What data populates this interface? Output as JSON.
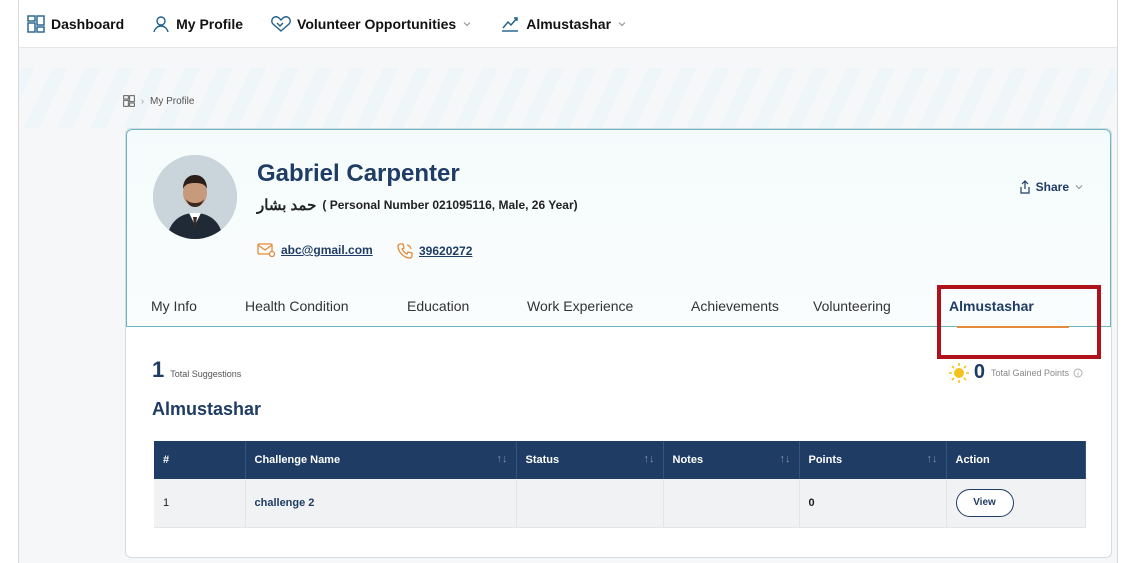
{
  "nav": {
    "dashboard": "Dashboard",
    "my_profile": "My Profile",
    "volunteer": "Volunteer Opportunities",
    "almustashar": "Almustashar"
  },
  "breadcrumb": {
    "current": "My Profile"
  },
  "profile": {
    "name": "Gabriel Carpenter",
    "arabic_name": "حمد بشار",
    "details": "( Personal Number 021095116, Male, 26 Year)",
    "email": "abc@gmail.com",
    "phone": "39620272",
    "share_label": "Share"
  },
  "tabs": [
    {
      "label": "My Info"
    },
    {
      "label": "Health Condition"
    },
    {
      "label": "Education"
    },
    {
      "label": "Work Experience"
    },
    {
      "label": "Achievements"
    },
    {
      "label": "Volunteering"
    },
    {
      "label": "Almustashar"
    }
  ],
  "stats": {
    "total_suggestions": "1",
    "total_suggestions_label": "Total Suggestions",
    "gained_points": "0",
    "gained_points_label": "Total Gained Points"
  },
  "section_title": "Almustashar",
  "table": {
    "headers": [
      "#",
      "Challenge Name",
      "Status",
      "Notes",
      "Points",
      "Action"
    ],
    "rows": [
      {
        "index": "1",
        "challenge": "challenge 2",
        "status": "",
        "notes": "",
        "points": "0",
        "action": "View"
      }
    ]
  },
  "colors": {
    "primary": "#1f3c64",
    "accent": "#e48a3a",
    "highlight": "#b0121b",
    "header_border": "#69b7c6"
  }
}
